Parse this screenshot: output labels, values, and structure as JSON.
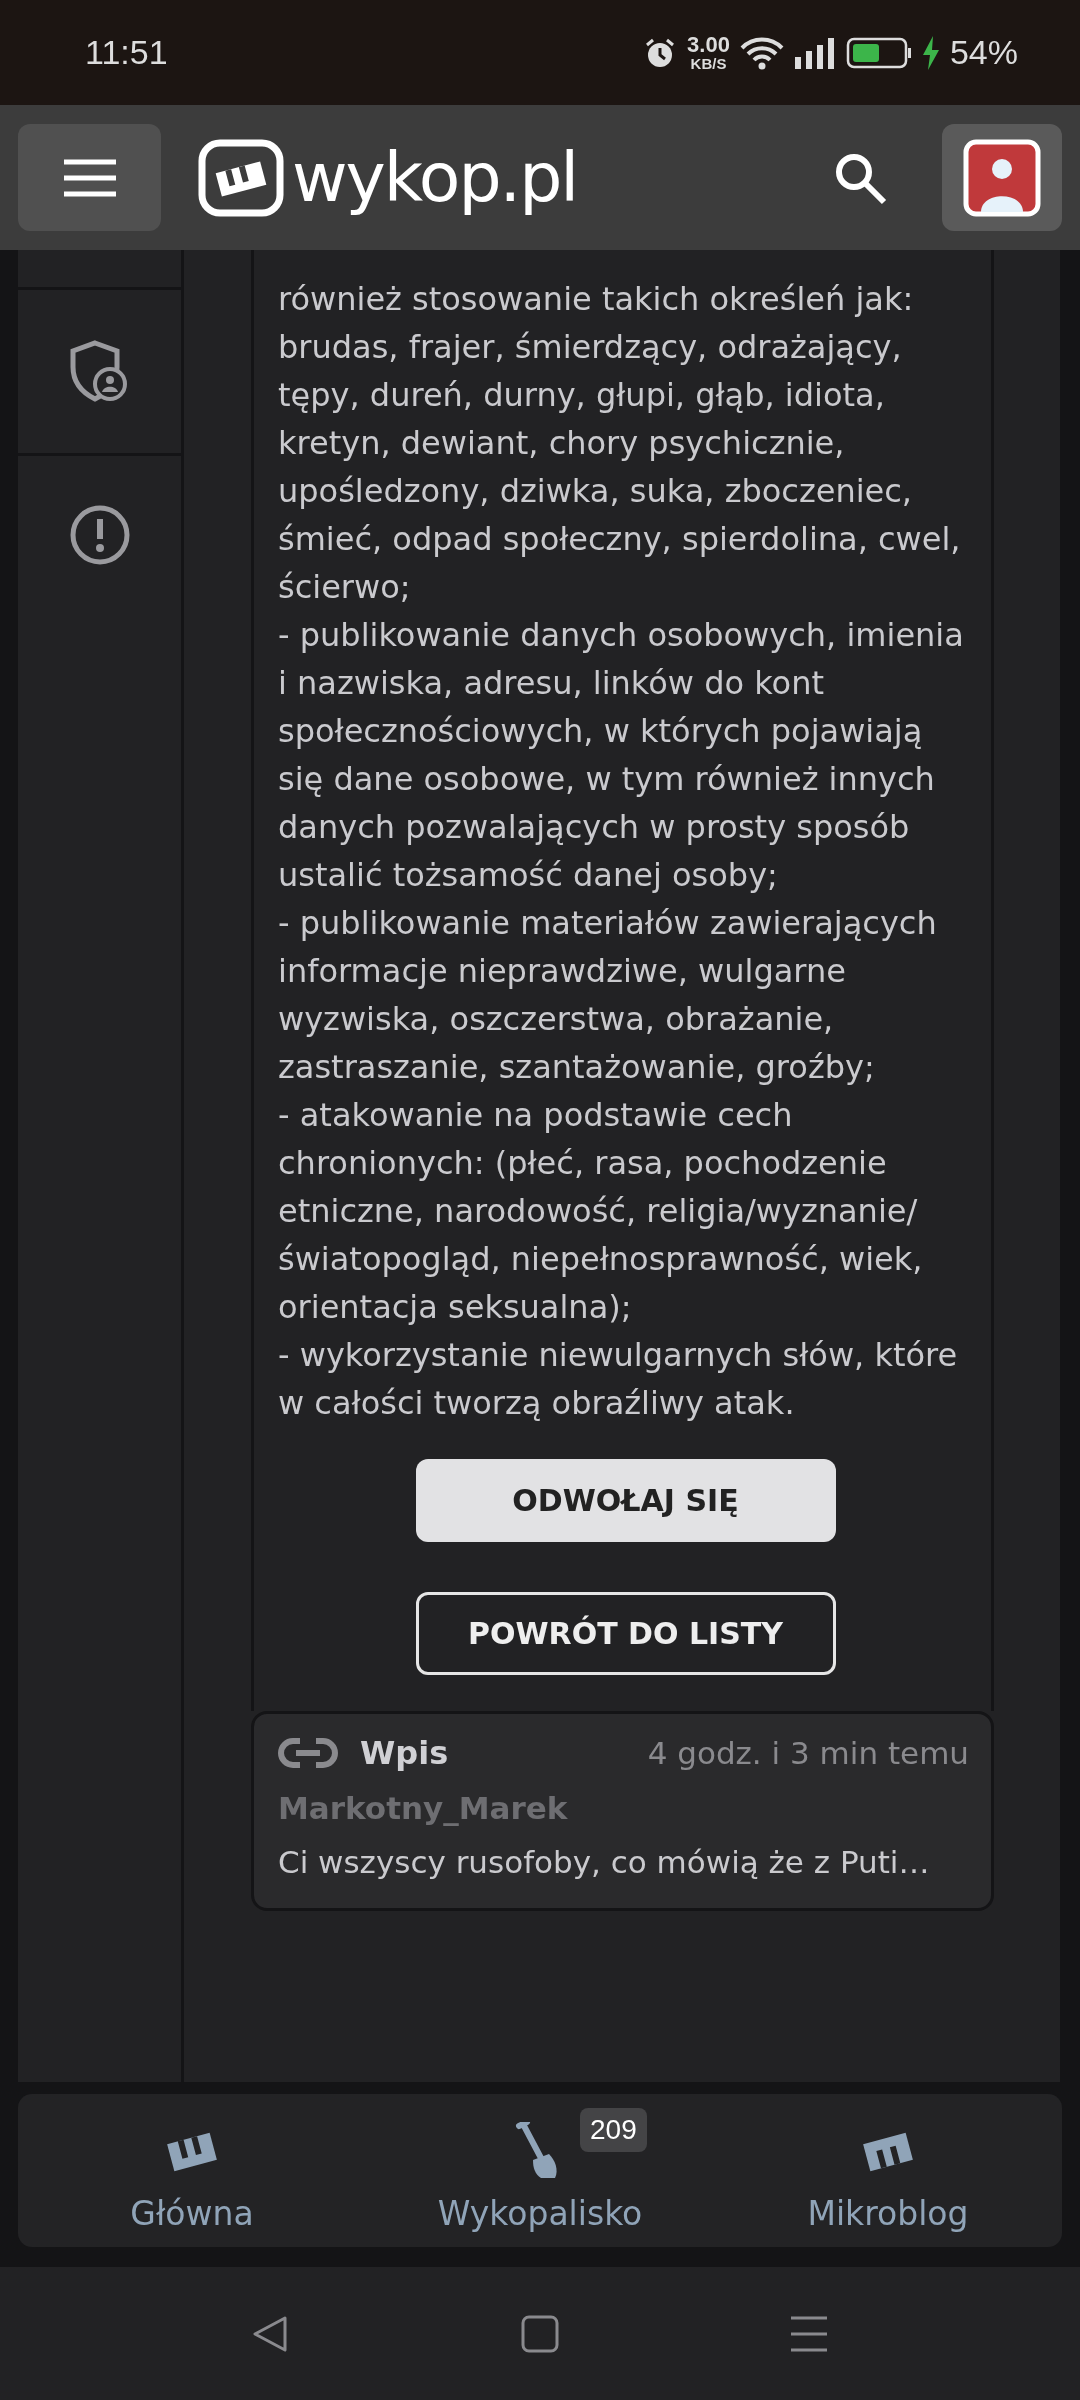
{
  "status_bar": {
    "time": "11:51",
    "net_speed": "3.00",
    "net_unit": "KB/S",
    "battery": "54%"
  },
  "header": {
    "logo": "wykop.pl"
  },
  "sidebar": {
    "items": [
      {
        "kind": "shield"
      },
      {
        "kind": "alert"
      }
    ]
  },
  "rules": {
    "paragraphs": [
      "również stosowanie takich określeń jak: brudas, frajer, śmierdzący, odrażający, tępy, dureń, durny, głupi, głąb, idiota, kretyn, dewiant, chory psychicznie, upośledzony, dziwka, suka, zboczeniec, śmieć, odpad społeczny, spierdolina, cwel, ścierwo;",
      "- publikowanie danych osobowych, imienia i nazwiska, adresu, linków do kont społecznościowych, w których pojawiają się dane osobowe, w tym również innych danych pozwalających w prosty sposób ustalić tożsamość danej osoby;",
      "- publikowanie materiałów zawierających informacje nieprawdziwe, wulgarne wyzwiska, oszczerstwa, obrażanie, zastraszanie, szantażowanie, groźby;",
      "- atakowanie na podstawie cech chronionych: (płeć, rasa, pochodzenie etniczne, narodowość, religia/wyznanie/światopogląd, niepełnosprawność, wiek, orientacja seksualna);",
      "- wykorzystanie niewulgarnych słów, które w całości tworzą obraźliwy atak."
    ]
  },
  "buttons": [
    {
      "label": "ODWOŁAJ SIĘ",
      "kind": "primary"
    },
    {
      "label": "POWRÓT DO LISTY",
      "kind": "outline"
    }
  ],
  "linked_entry": {
    "type": "Wpis",
    "time": "4 godz. i 3 min temu",
    "author": "Markotny_Marek",
    "excerpt": "Ci wszyscy rusofoby, co mówią że z Puti…"
  },
  "bottom_nav": [
    {
      "label": "Główna",
      "kind": "home"
    },
    {
      "label": "Wykopalisko",
      "kind": "dig",
      "badge": "209"
    },
    {
      "label": "Mikroblog",
      "kind": "micro"
    }
  ]
}
